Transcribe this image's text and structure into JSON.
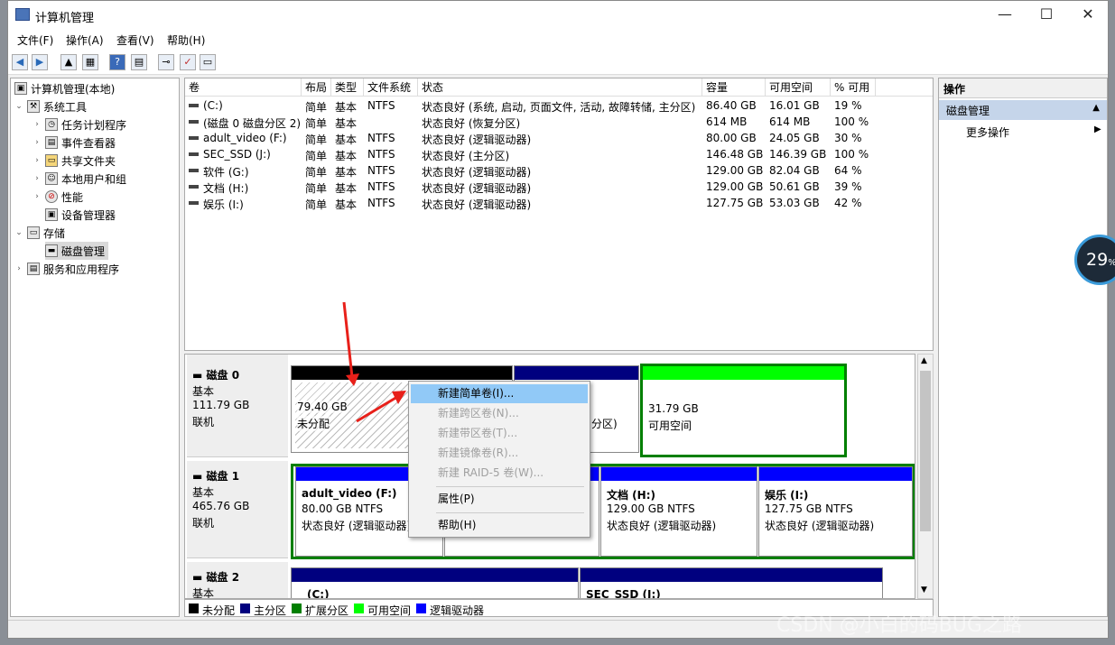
{
  "window": {
    "title": "计算机管理",
    "min": "—",
    "max": "☐",
    "close": "✕"
  },
  "menu": [
    "文件(F)",
    "操作(A)",
    "查看(V)",
    "帮助(H)"
  ],
  "tree": [
    {
      "label": "计算机管理(本地)",
      "arrow": ""
    },
    {
      "label": "系统工具",
      "arrow": "⌄"
    },
    {
      "label": "任务计划程序",
      "arrow": "›"
    },
    {
      "label": "事件查看器",
      "arrow": "›"
    },
    {
      "label": "共享文件夹",
      "arrow": "›"
    },
    {
      "label": "本地用户和组",
      "arrow": "›"
    },
    {
      "label": "性能",
      "arrow": "›"
    },
    {
      "label": "设备管理器",
      "arrow": ""
    },
    {
      "label": "存储",
      "arrow": "⌄"
    },
    {
      "label": "磁盘管理",
      "arrow": ""
    },
    {
      "label": "服务和应用程序",
      "arrow": "›"
    }
  ],
  "volumes": {
    "headers": [
      "卷",
      "布局",
      "类型",
      "文件系统",
      "状态",
      "容量",
      "可用空间",
      "% 可用"
    ],
    "rows": [
      [
        "(C:)",
        "简单",
        "基本",
        "NTFS",
        "状态良好 (系统, 启动, 页面文件, 活动, 故障转储, 主分区)",
        "86.40 GB",
        "16.01 GB",
        "19 %"
      ],
      [
        "(磁盘 0 磁盘分区 2)",
        "简单",
        "基本",
        "",
        "状态良好 (恢复分区)",
        "614 MB",
        "614 MB",
        "100 %"
      ],
      [
        "adult_video (F:)",
        "简单",
        "基本",
        "NTFS",
        "状态良好 (逻辑驱动器)",
        "80.00 GB",
        "24.05 GB",
        "30 %"
      ],
      [
        "SEC_SSD (J:)",
        "简单",
        "基本",
        "NTFS",
        "状态良好 (主分区)",
        "146.48 GB",
        "146.39 GB",
        "100 %"
      ],
      [
        "软件 (G:)",
        "简单",
        "基本",
        "NTFS",
        "状态良好 (逻辑驱动器)",
        "129.00 GB",
        "82.04 GB",
        "64 %"
      ],
      [
        "文档 (H:)",
        "简单",
        "基本",
        "NTFS",
        "状态良好 (逻辑驱动器)",
        "129.00 GB",
        "50.61 GB",
        "39 %"
      ],
      [
        "娱乐 (I:)",
        "简单",
        "基本",
        "NTFS",
        "状态良好 (逻辑驱动器)",
        "127.75 GB",
        "53.03 GB",
        "42 %"
      ]
    ]
  },
  "disks": {
    "disk0": {
      "name": "磁盘 0",
      "type": "基本",
      "size": "111.79 GB",
      "status": "联机",
      "unalloc_size": "79.40 GB",
      "unalloc_label": "未分配",
      "p2_tail": "分区)",
      "free_size": "31.79 GB",
      "free_label": "可用空间"
    },
    "disk1": {
      "name": "磁盘 1",
      "type": "基本",
      "size": "465.76 GB",
      "status": "联机",
      "f_name": "adult_video  (F:)",
      "f_size": "80.00 GB NTFS",
      "f_status": "状态良好 (逻辑驱动器)",
      "h_name": "文档  (H:)",
      "h_size": "129.00 GB NTFS",
      "h_status": "状态良好 (逻辑驱动器)",
      "i_name": "娱乐  (I:)",
      "i_size": "127.75 GB NTFS",
      "i_status": "状态良好 (逻辑驱动器)"
    },
    "disk2": {
      "name": "磁盘 2",
      "type": "基本",
      "c_name": "(C:)",
      "j_name": "SEC_SSD  (J:)"
    }
  },
  "legend": [
    "未分配",
    "主分区",
    "扩展分区",
    "可用空间",
    "逻辑驱动器"
  ],
  "colors": {
    "unalloc": "#000000",
    "primary": "#00007f",
    "extended": "#007f00",
    "free": "#00ff00",
    "logical": "#0000ff"
  },
  "context_menu": [
    {
      "label": "新建简单卷(I)...",
      "state": "highlight"
    },
    {
      "label": "新建跨区卷(N)...",
      "state": "disabled"
    },
    {
      "label": "新建带区卷(T)...",
      "state": "disabled"
    },
    {
      "label": "新建镜像卷(R)...",
      "state": "disabled"
    },
    {
      "label": "新建 RAID-5 卷(W)...",
      "state": "disabled"
    },
    {
      "label": "属性(P)",
      "state": "normal"
    },
    {
      "label": "帮助(H)",
      "state": "normal"
    }
  ],
  "actions": {
    "header": "操作",
    "section": "磁盘管理",
    "more": "更多操作"
  },
  "badge": "29",
  "badge_unit": "%",
  "watermark": "CSDN @小白的码BUG之路"
}
